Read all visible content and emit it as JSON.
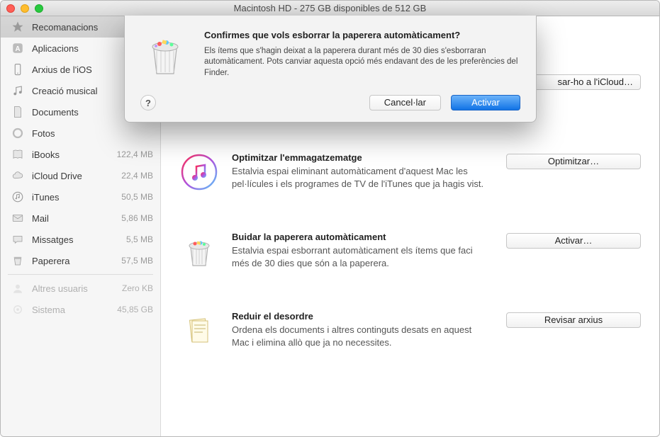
{
  "window": {
    "title": "Macintosh HD - 275 GB disponibles de 512 GB"
  },
  "sidebar": {
    "items": [
      {
        "label": "Recomanacions",
        "size": "",
        "icon": "star",
        "selected": true
      },
      {
        "label": "Aplicacions",
        "size": "",
        "icon": "app"
      },
      {
        "label": "Arxius de l'iOS",
        "size": "",
        "icon": "phone"
      },
      {
        "label": "Creació musical",
        "size": "",
        "icon": "music-note"
      },
      {
        "label": "Documents",
        "size": "",
        "icon": "doc"
      },
      {
        "label": "Fotos",
        "size": "",
        "icon": "photos"
      },
      {
        "label": "iBooks",
        "size": "122,4 MB",
        "icon": "book"
      },
      {
        "label": "iCloud Drive",
        "size": "22,4 MB",
        "icon": "cloud"
      },
      {
        "label": "iTunes",
        "size": "50,5 MB",
        "icon": "itunes"
      },
      {
        "label": "Mail",
        "size": "5,86 MB",
        "icon": "mail"
      },
      {
        "label": "Missatges",
        "size": "5,5 MB",
        "icon": "messages"
      },
      {
        "label": "Paperera",
        "size": "57,5 MB",
        "icon": "trash"
      }
    ],
    "dim_items": [
      {
        "label": "Altres usuaris",
        "size": "Zero KB",
        "icon": "user"
      },
      {
        "label": "Sistema",
        "size": "45,85 GB",
        "icon": "gear"
      }
    ]
  },
  "main": {
    "row_hidden": {
      "button": "sar-ho a l'iCloud…"
    },
    "rows": [
      {
        "title": "Optimitzar l'emmagatzematge",
        "desc": "Estalvia espai eliminant automàticament d'aquest Mac les pel·lícules i els programes de TV de l'iTunes que ja hagis vist.",
        "button": "Optimitzar…",
        "icon": "itunes"
      },
      {
        "title": "Buidar la paperera automàticament",
        "desc": "Estalvia espai esborrant automàticament els ítems que faci més de 30 dies que són a la paperera.",
        "button": "Activar…",
        "icon": "trash"
      },
      {
        "title": "Reduir el desordre",
        "desc": "Ordena els documents i altres continguts desats en aquest Mac i elimina allò que ja no necessites.",
        "button": "Revisar arxius",
        "icon": "docs"
      }
    ]
  },
  "dialog": {
    "title": "Confirmes que vols esborrar la paperera automàticament?",
    "desc": "Els ítems que s'hagin deixat a la paperera durant més de 30 dies s'esborraran automàticament. Pots canviar aquesta opció més endavant des de les preferències del Finder.",
    "help": "?",
    "cancel": "Cancel·lar",
    "confirm": "Activar"
  }
}
